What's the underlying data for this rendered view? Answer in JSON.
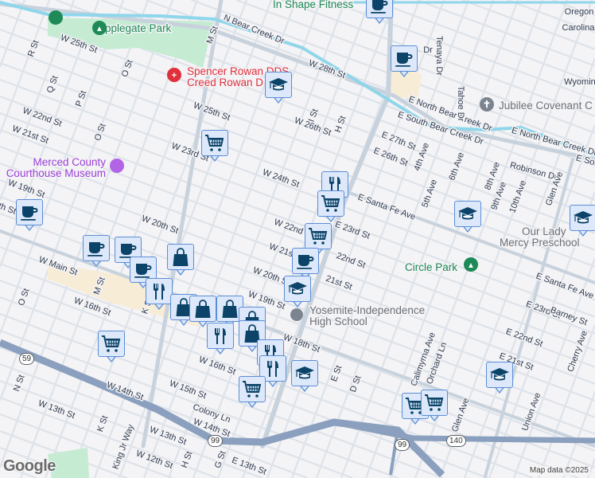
{
  "map": {
    "attribution": "Map data ©2025",
    "logo": "Google",
    "route_shields": [
      "59",
      "99",
      "99",
      "140"
    ],
    "pois": {
      "applegate_park": "Applegate Park",
      "spencer_rowan_1": "Spencer Rowan DDS",
      "spencer_rowan_2": "Creed Rowan D",
      "museum_1": "Merced County",
      "museum_2": "Courthouse Museum",
      "jubilee": "Jubilee Covenant C",
      "our_lady_1": "Our Lady",
      "our_lady_2": "Mercy Preschool",
      "circle_park": "Circle Park",
      "yosemite_1": "Yosemite-Independence",
      "yosemite_2": "High School",
      "in_shape": "In Shape Fitness"
    },
    "streets": [
      "W 25th St",
      "R St",
      "M St",
      "N Bear Creek Dr",
      "W 28th St",
      "Q St",
      "P St",
      "O St",
      "O St",
      "W 25th St",
      "W 22nd St",
      "W 21st St",
      "I St",
      "W 26th St",
      "H St",
      "E 27th St",
      "E 26th St",
      "E North Bear Creek Dr",
      "E South Bear Creek Dr",
      "E North Bear Creek Dr",
      "E Sou",
      "Tenaya Dr",
      "Tahoe Dr",
      "4th Ave",
      "5th Ave",
      "6th Ave",
      "8th Ave",
      "9th Ave",
      "10th Ave",
      "Robinson Dr",
      "Glen Ave",
      "Oregon",
      "Carolina",
      "Wyoming",
      "W 23rd St",
      "W 24th St",
      "W 19th St",
      "W 20th St",
      "W 22nd St",
      "E Santa Fe Ave",
      "E 23rd St",
      "th St",
      "W Main St",
      "M St",
      "O St",
      "W 16th St",
      "W 21st St",
      "22nd St",
      "21st St",
      "W 20th St",
      "W 19th St",
      "E Santa Fe Ave",
      "E 23rd St",
      "Barney St",
      "E 22nd St",
      "E 21st St",
      "Cherry Ave",
      "W 16th St",
      "W 18th St",
      "W 15th St",
      "W 14th St",
      "W 13th St",
      "N St",
      "Colony Ln",
      "W 14th St",
      "W 13th St",
      "K St",
      "King Jr Way",
      "W 12th St",
      "H St",
      "G St",
      "E 13th St",
      "E St",
      "D St",
      "Calimyrna Ave",
      "Orchard Ln",
      "Glen Ave",
      "Union Ave",
      "Dr",
      "K St"
    ],
    "markers": [
      "coffee",
      "coffee",
      "school",
      "shopping-cart",
      "restaurant",
      "shopping-cart",
      "shopping-cart",
      "coffee",
      "school",
      "school",
      "coffee",
      "coffee",
      "shopping-bag",
      "coffee",
      "coffee",
      "school",
      "restaurant",
      "shopping-bag",
      "shopping-bag",
      "shopping-bag",
      "shopping-bag",
      "restaurant",
      "shopping-bag",
      "restaurant",
      "restaurant",
      "school",
      "shopping-cart",
      "shopping-cart",
      "shopping-cart",
      "shopping-cart",
      "school"
    ]
  },
  "colors": {
    "water": "#8fd6ea",
    "park": "#c5ecd3",
    "highway": "#8aa0be",
    "road": "#dbe2ea",
    "pin_fill": "#dde8fb",
    "pin_icon": "#0b4468"
  }
}
